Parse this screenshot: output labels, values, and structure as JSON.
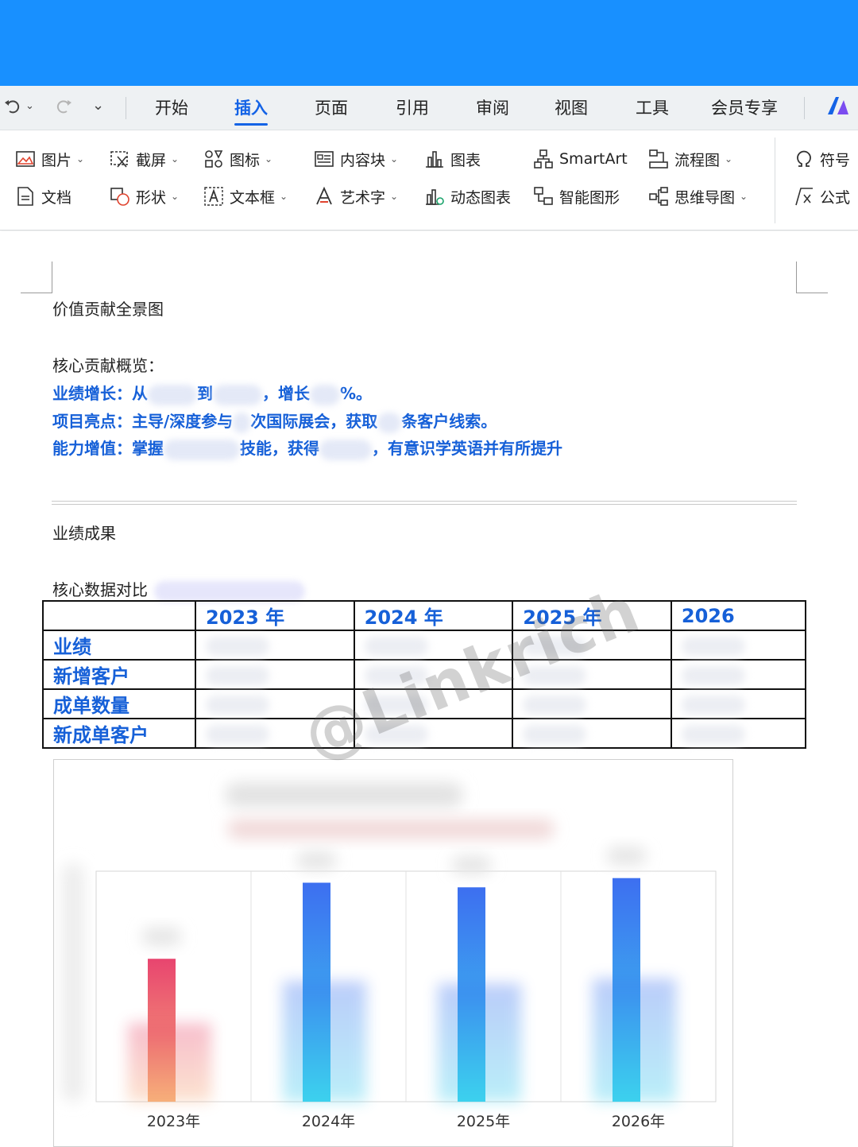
{
  "quick_access": {
    "undo_icon": "undo-icon",
    "redo_icon": "redo-icon",
    "more_icon": "chevron-down-icon"
  },
  "menu_tabs": [
    "开始",
    "插入",
    "页面",
    "引用",
    "审阅",
    "视图",
    "工具",
    "会员专享"
  ],
  "active_tab": "插入",
  "ribbon": {
    "row1": [
      {
        "label": "图片",
        "icon": "image-icon",
        "dropdown": true
      },
      {
        "label": "截屏",
        "icon": "screenshot-icon",
        "dropdown": true
      },
      {
        "label": "图标",
        "icon": "icons-icon",
        "dropdown": true
      },
      {
        "label": "内容块",
        "icon": "content-block-icon",
        "dropdown": true
      },
      {
        "label": "图表",
        "icon": "chart-icon",
        "dropdown": false
      },
      {
        "label": "SmartArt",
        "icon": "smartart-icon",
        "dropdown": false
      },
      {
        "label": "流程图",
        "icon": "flowchart-icon",
        "dropdown": true
      },
      {
        "label": "符号",
        "icon": "omega-icon",
        "dropdown": false
      }
    ],
    "row2": [
      {
        "label": "文档",
        "icon": "document-icon",
        "dropdown": false
      },
      {
        "label": "形状",
        "icon": "shapes-icon",
        "dropdown": true
      },
      {
        "label": "文本框",
        "icon": "textbox-icon",
        "dropdown": true
      },
      {
        "label": "艺术字",
        "icon": "wordart-icon",
        "dropdown": true
      },
      {
        "label": "动态图表",
        "icon": "dynamic-chart-icon",
        "dropdown": false
      },
      {
        "label": "智能图形",
        "icon": "smart-graphic-icon",
        "dropdown": false
      },
      {
        "label": "思维导图",
        "icon": "mindmap-icon",
        "dropdown": true
      },
      {
        "label": "公式",
        "icon": "formula-icon",
        "dropdown": false
      }
    ]
  },
  "document": {
    "title": "价值贡献全景图",
    "overview_heading": "核心贡献概览：",
    "line1": {
      "a": "业绩增长：从",
      "b": "到",
      "c": "，增长",
      "d": "%。"
    },
    "line2": {
      "a": "项目亮点：主导/深度参与",
      "b": "次国际展会，获取",
      "c": "条客户线索。"
    },
    "line3": {
      "a": "能力增值：掌握",
      "b": "技能，获得",
      "c": "，有意识学英语并有所提升"
    },
    "section_title": "业绩成果",
    "compare_heading": "核心数据对比",
    "table": {
      "headers": [
        "",
        "2023 年",
        "2024 年",
        "2025 年",
        "2026"
      ],
      "rows": [
        "业绩",
        "新增客户",
        "成单数量",
        "新成单客户"
      ]
    },
    "watermark": "@Linkrich"
  },
  "chart_data": {
    "type": "bar",
    "categories": [
      "2023年",
      "2024年",
      "2025年",
      "2026年"
    ],
    "values": [
      0.62,
      0.95,
      0.93,
      0.97
    ],
    "value_scale": "relative height; actual values blurred",
    "colors": {
      "2023年": "#e8456f",
      "2024年": "#3d6ff0",
      "2025年": "#3d6ff0",
      "2026年": "#3d6ff0"
    }
  }
}
